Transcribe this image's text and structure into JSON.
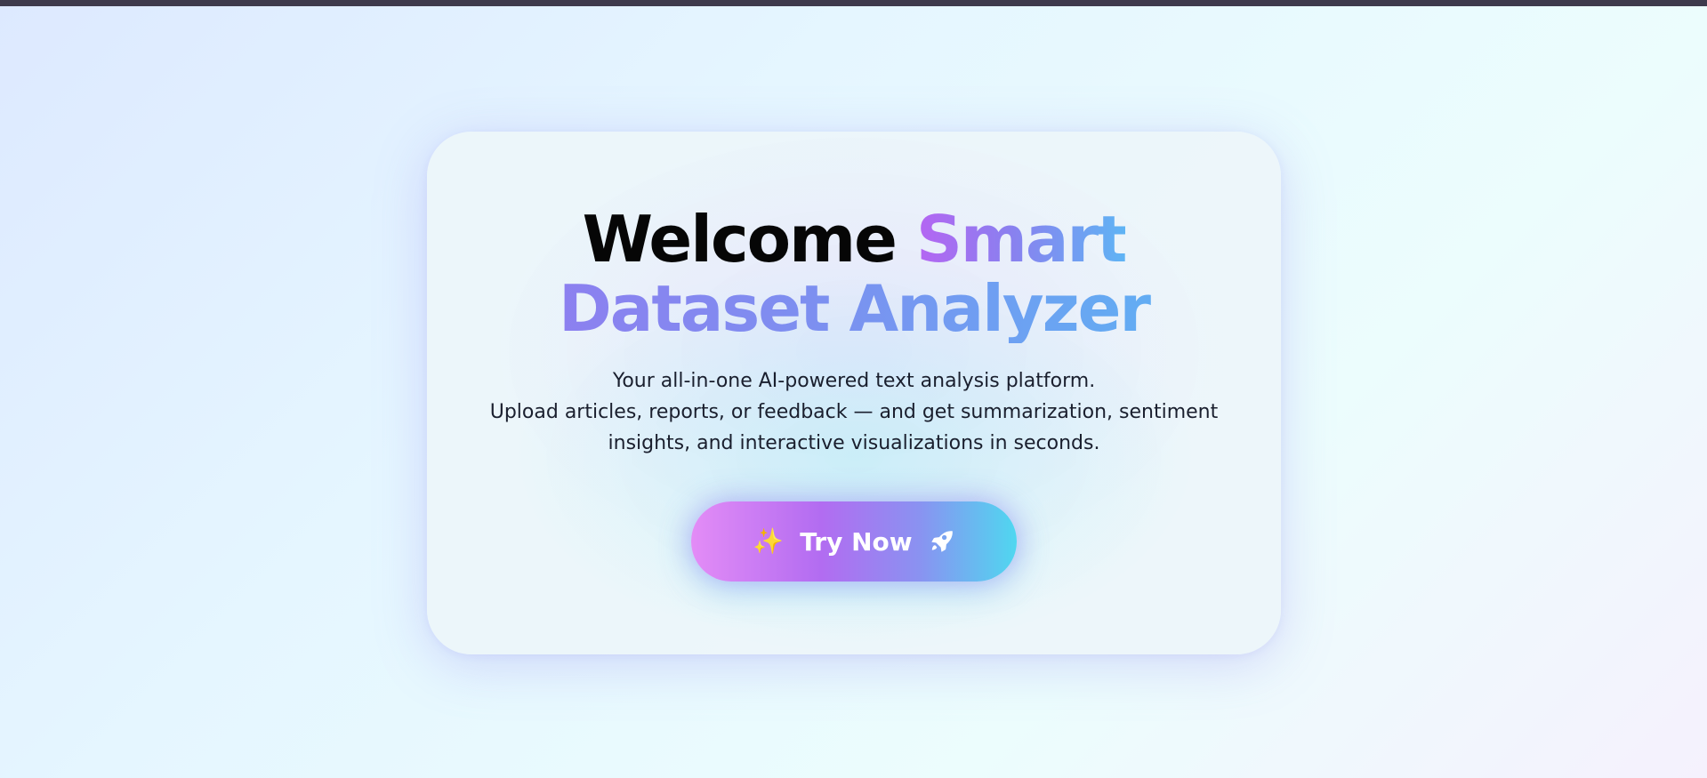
{
  "hero": {
    "title_lead": "Welcome",
    "title_highlight": "Smart",
    "title_line2": "Dataset Analyzer",
    "description": [
      "Your all-in-one AI-powered text analysis platform.",
      "Upload articles, reports, or feedback — and get summarization, sentiment",
      "insights, and interactive visualizations in seconds."
    ],
    "button": {
      "label": "Try Now",
      "leading_icon": "sparkles-icon",
      "trailing_icon": "rocket-icon"
    }
  },
  "colors": {
    "top_bar": "#3e3a4c",
    "title_gradient_start": "#b565f2",
    "title_gradient_end": "#58b8f4",
    "button_gradient_start": "#e38cf6",
    "button_gradient_end": "#4fd7f0",
    "description_text": "#1a1f2e"
  }
}
